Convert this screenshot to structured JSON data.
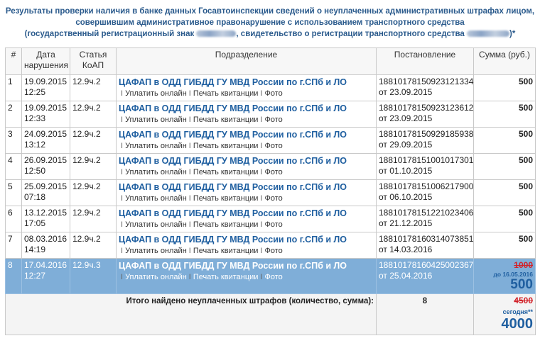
{
  "header": {
    "line1": "Результаты проверки наличия в банке данных Госавтоинспекции сведений о неуплаченных административных штрафах лицом,",
    "line2": "совершившим административное правонарушение с использованием транспортного средства",
    "line3_prefix": "(государственный регистрационный знак ",
    "line3_middle": ", свидетельство о регистрации транспортного средства ",
    "line3_suffix": ")*"
  },
  "table": {
    "columns": [
      "#",
      "Дата нарушения",
      "Статья КоАП",
      "Подразделение",
      "Постановление",
      "Сумма (руб.)"
    ],
    "action_pay": "Уплатить онлайн",
    "action_print": "Печать квитанции",
    "action_photo": "Фото",
    "separator": "I",
    "rows": [
      {
        "num": "1",
        "date": "19.09.2015",
        "time": "12:25",
        "article": "12.9ч.2",
        "department": "ЦАФАП в ОДД ГИБДД ГУ МВД России по г.СПб и ЛО",
        "resolution": "18810178150923121334",
        "resolution_date": "от 23.09.2015",
        "amount": "500"
      },
      {
        "num": "2",
        "date": "19.09.2015",
        "time": "12:33",
        "article": "12.9ч.2",
        "department": "ЦАФАП в ОДД ГИБДД ГУ МВД России по г.СПб и ЛО",
        "resolution": "18810178150923123612",
        "resolution_date": "от 23.09.2015",
        "amount": "500"
      },
      {
        "num": "3",
        "date": "24.09.2015",
        "time": "13:12",
        "article": "12.9ч.2",
        "department": "ЦАФАП в ОДД ГИБДД ГУ МВД России по г.СПб и ЛО",
        "resolution": "18810178150929185938",
        "resolution_date": "от 29.09.2015",
        "amount": "500"
      },
      {
        "num": "4",
        "date": "26.09.2015",
        "time": "12:50",
        "article": "12.9ч.2",
        "department": "ЦАФАП в ОДД ГИБДД ГУ МВД России по г.СПб и ЛО",
        "resolution": "18810178151001017301",
        "resolution_date": "от 01.10.2015",
        "amount": "500"
      },
      {
        "num": "5",
        "date": "25.09.2015",
        "time": "07:18",
        "article": "12.9ч.2",
        "department": "ЦАФАП в ОДД ГИБДД ГУ МВД России по г.СПб и ЛО",
        "resolution": "18810178151006217900",
        "resolution_date": "от 06.10.2015",
        "amount": "500"
      },
      {
        "num": "6",
        "date": "13.12.2015",
        "time": "17:05",
        "article": "12.9ч.2",
        "department": "ЦАФАП в ОДД ГИБДД ГУ МВД России по г.СПб и ЛО",
        "resolution": "18810178151221023406",
        "resolution_date": "от 21.12.2015",
        "amount": "500"
      },
      {
        "num": "7",
        "date": "08.03.2016",
        "time": "14:19",
        "article": "12.9ч.2",
        "department": "ЦАФАП в ОДД ГИБДД ГУ МВД России по г.СПб и ЛО",
        "resolution": "18810178160314073851",
        "resolution_date": "от 14.03.2016",
        "amount": "500"
      }
    ],
    "selected_row": {
      "num": "8",
      "date": "17.04.2016",
      "time": "12:27",
      "article": "12.9ч.3",
      "department": "ЦАФАП в ОДД ГИБДД ГУ МВД России по г.СПб и ЛО",
      "resolution": "18810178160425002367",
      "resolution_date": "от 25.04.2016",
      "old_amount": "1000",
      "discount_note": "до 16.05.2016",
      "new_amount": "500"
    },
    "total": {
      "label": "Итого найдено неуплаченных штрафов (количество, сумма):",
      "count": "8",
      "old_sum": "4500",
      "today_note": "сегодня**",
      "new_sum": "4000"
    }
  },
  "colors": {
    "accent": "#1f5fa0",
    "selected_row_bg": "#7faed8",
    "strike_red": "#d2232a"
  }
}
